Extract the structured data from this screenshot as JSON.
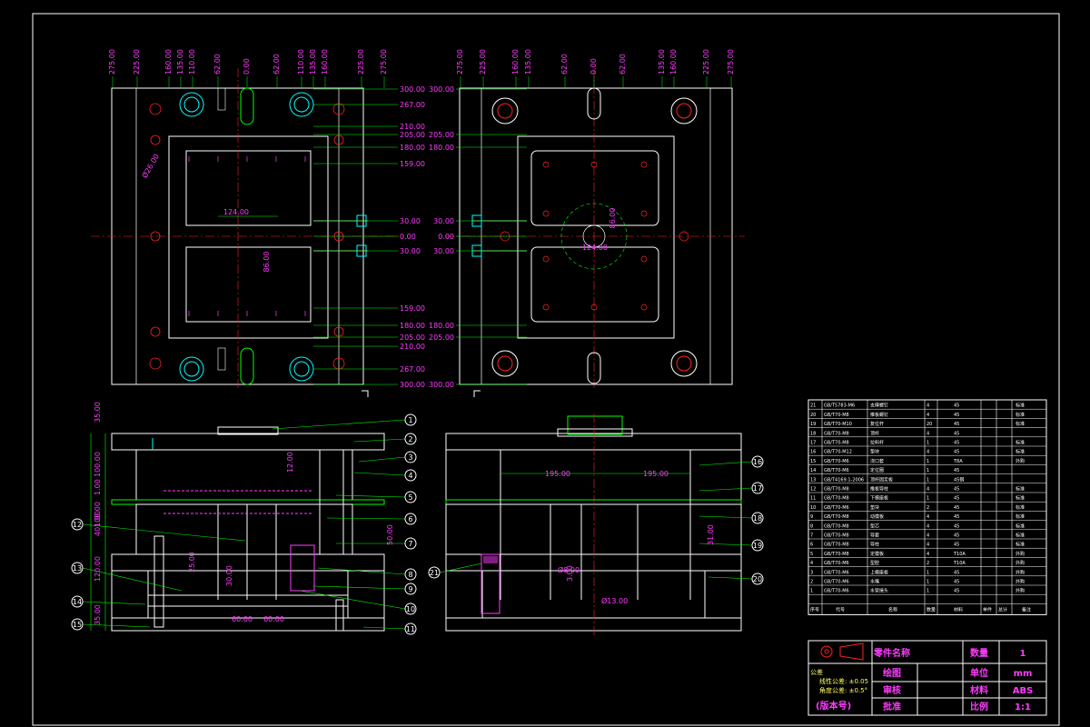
{
  "top_left": {
    "dims_top": [
      "275.00",
      "225.00",
      "160.00",
      "135.00",
      "110.00",
      "62.00",
      "0.00",
      "62.00",
      "110.00",
      "135.00",
      "160.00",
      "225.00",
      "275.00"
    ],
    "dims_right": [
      "300.00",
      "267.00",
      "210.00",
      "205.00",
      "180.00",
      "159.00",
      "30.00",
      "0.00",
      "30.00",
      "159.00",
      "180.00",
      "205.00",
      "210.00",
      "267.00",
      "300.00"
    ],
    "dim_width": "124.00",
    "dim_height": "86.00",
    "dim_diameter": "Ø26.00"
  },
  "top_right": {
    "dims_top": [
      "275.00",
      "225.00",
      "160.00",
      "135.00",
      "62.00",
      "0.00",
      "62.00",
      "135.00",
      "160.00",
      "225.00",
      "275.00"
    ],
    "dims_left": [
      "300.00",
      "205.00",
      "180.00",
      "30.00",
      "0.00",
      "30.00",
      "180.00",
      "205.00",
      "300.00"
    ],
    "dim_center_h": "124.00",
    "dim_center_v": "86.00"
  },
  "section_left": {
    "balloons": [
      "1",
      "2",
      "3",
      "4",
      "5",
      "6",
      "7",
      "8",
      "9",
      "10",
      "11",
      "12",
      "13",
      "14",
      "15"
    ],
    "dims_left": [
      "35.00",
      "100.00",
      "1.00",
      "100.00",
      "401.00",
      "120.00",
      "35.00"
    ],
    "dims_inner": [
      "12.00",
      "25.00",
      "30.00",
      "60.00",
      "60.00",
      "50.00"
    ]
  },
  "section_right": {
    "balloons": [
      "16",
      "17",
      "18",
      "19",
      "20",
      "21"
    ],
    "dims": [
      "195.00",
      "195.00",
      "Ø8.00",
      "3.00",
      "Ø13.00",
      "31.00"
    ]
  },
  "bom": {
    "rows": [
      {
        "no": "21",
        "code": "GB/T5783-M6",
        "name": "支撑螺钉",
        "qty": "4",
        "mat": "45",
        "note": "标准"
      },
      {
        "no": "20",
        "code": "GB/T70-M8",
        "name": "推板螺钉",
        "qty": "4",
        "mat": "45",
        "note": "标准"
      },
      {
        "no": "19",
        "code": "GB/T70-M10",
        "name": "复位杆",
        "qty": "20",
        "mat": "45",
        "note": "标准"
      },
      {
        "no": "18",
        "code": "GB/T70-M8",
        "name": "顶杆",
        "qty": "4",
        "mat": "45",
        "note": ""
      },
      {
        "no": "17",
        "code": "GB/T70-M8",
        "name": "拉料杆",
        "qty": "1",
        "mat": "45",
        "note": "标准"
      },
      {
        "no": "16",
        "code": "GB/T70-M12",
        "name": "垫块",
        "qty": "4",
        "mat": "45",
        "note": "标准"
      },
      {
        "no": "15",
        "code": "GB/T70-M6",
        "name": "浇口套",
        "qty": "1",
        "mat": "T8A",
        "note": "外购"
      },
      {
        "no": "14",
        "code": "GB/T70-M6",
        "name": "定位圈",
        "qty": "1",
        "mat": "45",
        "note": ""
      },
      {
        "no": "13",
        "code": "GB/T4169.1-2006",
        "name": "顶杆固定板",
        "qty": "1",
        "mat": "45钢",
        "note": ""
      },
      {
        "no": "12",
        "code": "GB/T70-M8",
        "name": "推板导柱",
        "qty": "4",
        "mat": "45",
        "note": "标准"
      },
      {
        "no": "11",
        "code": "GB/T70-M8",
        "name": "下模座板",
        "qty": "1",
        "mat": "45",
        "note": "标准"
      },
      {
        "no": "10",
        "code": "GB/T70-M6",
        "name": "垫块",
        "qty": "2",
        "mat": "45",
        "note": "标准"
      },
      {
        "no": "9",
        "code": "GB/T70-M8",
        "name": "动模板",
        "qty": "4",
        "mat": "45",
        "note": "标准"
      },
      {
        "no": "8",
        "code": "GB/T70-M8",
        "name": "型芯",
        "qty": "4",
        "mat": "45",
        "note": "标准"
      },
      {
        "no": "7",
        "code": "GB/T70-M8",
        "name": "导套",
        "qty": "4",
        "mat": "45",
        "note": "标准"
      },
      {
        "no": "6",
        "code": "GB/T70-M8",
        "name": "导柱",
        "qty": "4",
        "mat": "45",
        "note": "标准"
      },
      {
        "no": "5",
        "code": "GB/T70-M8",
        "name": "定模板",
        "qty": "4",
        "mat": "T10A",
        "note": "外购"
      },
      {
        "no": "4",
        "code": "GB/T70-M6",
        "name": "型腔",
        "qty": "2",
        "mat": "T10A",
        "note": "外购"
      },
      {
        "no": "3",
        "code": "GB/T70-M6",
        "name": "上模座板",
        "qty": "1",
        "mat": "45",
        "note": "外购"
      },
      {
        "no": "2",
        "code": "GB/T70-M6",
        "name": "水嘴",
        "qty": "1",
        "mat": "45",
        "note": "外购"
      },
      {
        "no": "1",
        "code": "GB/T70-M6",
        "name": "水管接头",
        "qty": "1",
        "mat": "45",
        "note": "外购"
      }
    ],
    "header": {
      "no": "序号",
      "code": "代号",
      "name": "名称",
      "qty": "数量",
      "mat": "材料",
      "weight": "单件",
      "total": "总计",
      "note": "备注"
    }
  },
  "title_block": {
    "part_name_label": "零件名称",
    "draw_label": "绘图",
    "check_label": "审核",
    "approve_label": "批准",
    "qty_label": "数量",
    "qty_value": "1",
    "unit_label": "单位",
    "unit_value": "mm",
    "material_label": "材料",
    "material_value": "ABS",
    "scale_label": "比例",
    "scale_value": "1:1",
    "tolerance_title": "公差",
    "tol_line1": "线性公差: ±0.05",
    "tol_line2": "角度公差: ±0.5°",
    "version": "(版本号)"
  },
  "colors": {
    "background": "#000000",
    "outline": "#ffffff",
    "dimension": "#ff3cff",
    "center": "#ff2020",
    "green": "#00ff00",
    "cyan": "#00ffff",
    "yellow": "#ffff66"
  }
}
